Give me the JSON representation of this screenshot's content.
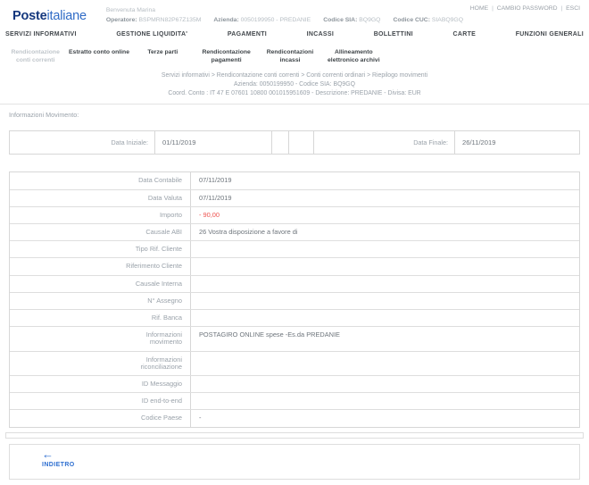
{
  "header": {
    "logo_bold": "Poste",
    "logo_light": "italiane",
    "welcome": "Benvenuta Marina",
    "operator_label": "Operatore:",
    "operator_value": "BSPMRN82P67Z135M",
    "azienda_label": "Azienda:",
    "azienda_value": "0050199950 - PREDANIE",
    "sia_label": "Codice SIA:",
    "sia_value": "BQ9GQ",
    "cuc_label": "Codice CUC:",
    "cuc_value": "SIABQ9GQ",
    "links": [
      "HOME",
      "CAMBIO PASSWORD",
      "ESCI"
    ],
    "links_divider": "|"
  },
  "nav": {
    "items": [
      "SERVIZI INFORMATIVI",
      "GESTIONE LIQUIDITA'",
      "PAGAMENTI",
      "INCASSI",
      "BOLLETTINI",
      "CARTE",
      "FUNZIONI GENERALI"
    ]
  },
  "subnav": {
    "items": [
      "Rendicontazione conti correnti",
      "Estratto conto online",
      "Terze parti",
      "Rendicontazione pagamenti",
      "Rendicontazioni incassi",
      "Allineamento elettronico archivi"
    ]
  },
  "breadcrumb": {
    "path": "Servizi informativi > Rendicontazione conti correnti > Conti correnti ordinari > Riepilogo movimenti",
    "account_line": "Azienda: 0050199950 - Codice SIA: BQ9GQ",
    "coord_line": "Coord. Conto : IT 47 E 07601 10800 001015951609 - Descrizione: PREDANIE - Divisa: EUR"
  },
  "section_title": "Informazioni Movimento:",
  "date_filter": {
    "start_label": "Data Iniziale:",
    "start_value": "01/11/2019",
    "end_label": "Data Finale:",
    "end_value": "26/11/2019"
  },
  "detail_rows": [
    {
      "label": "Data Contabile",
      "value": "07/11/2019"
    },
    {
      "label": "Data Valuta",
      "value": "07/11/2019"
    },
    {
      "label": "Importo",
      "value": "- 90,00"
    },
    {
      "label": "Causale ABI",
      "value": "26 Vostra disposizione a favore di"
    },
    {
      "label": "Tipo Rif. Cliente",
      "value": ""
    },
    {
      "label": "Riferimento Cliente",
      "value": ""
    },
    {
      "label": "Causale Interna",
      "value": ""
    },
    {
      "label": "N° Assegno",
      "value": ""
    },
    {
      "label": "Rif. Banca",
      "value": ""
    },
    {
      "label": "Informazioni movimento",
      "value": "POSTAGIRO ONLINE spese -Es.da PREDANIE"
    },
    {
      "label": "Informazioni riconciliazione",
      "value": ""
    },
    {
      "label": "ID Messaggio",
      "value": ""
    },
    {
      "label": "ID end-to-end",
      "value": ""
    },
    {
      "label": "Codice Paese",
      "value": "-"
    }
  ],
  "footer": {
    "back_icon": "←",
    "back_label": "INDIETRO"
  },
  "colors": {
    "poste_blue_dark": "#14377d",
    "poste_blue_light": "#2f6bc6",
    "link_blue": "#2e6fd0",
    "negative_amount_red": "#ee5350",
    "label_gray": "#9aa2aa",
    "value_gray": "#6e757c",
    "nav_text": "#43484d",
    "border_gray": "#d7d7d7"
  }
}
